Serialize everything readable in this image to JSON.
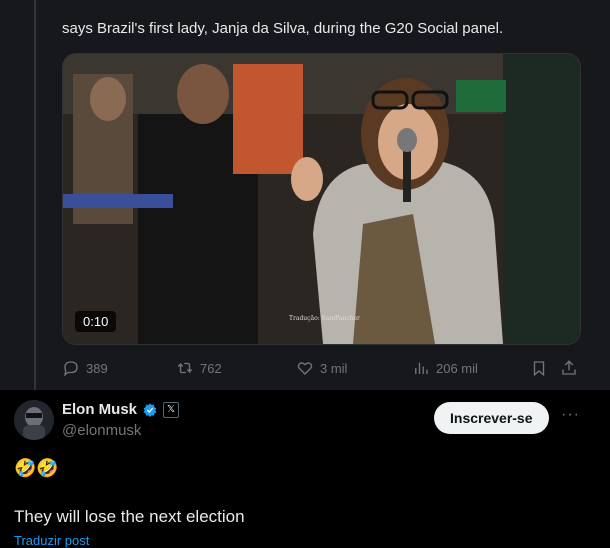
{
  "quoted_post": {
    "text": "says Brazil's first lady, Janja da Silva, during the G20 Social panel.",
    "video": {
      "duration": "0:10",
      "caption_watermark": "Tradução: SamPancher"
    },
    "actions": {
      "replies": "389",
      "reposts": "762",
      "likes": "3 mil",
      "views": "206 mil"
    }
  },
  "post": {
    "author_name": "Elon Musk",
    "author_handle": "@elonmusk",
    "badge_x": "𝕏",
    "subscribe_label": "Inscrever-se",
    "more_label": "···",
    "emojis": "🤣🤣",
    "text": "They will lose the next election",
    "translate_label": "Traduzir post"
  },
  "colors": {
    "accent": "#1d9bf0",
    "muted": "#71767b",
    "text": "#e7e9ea",
    "background": "#000000"
  }
}
